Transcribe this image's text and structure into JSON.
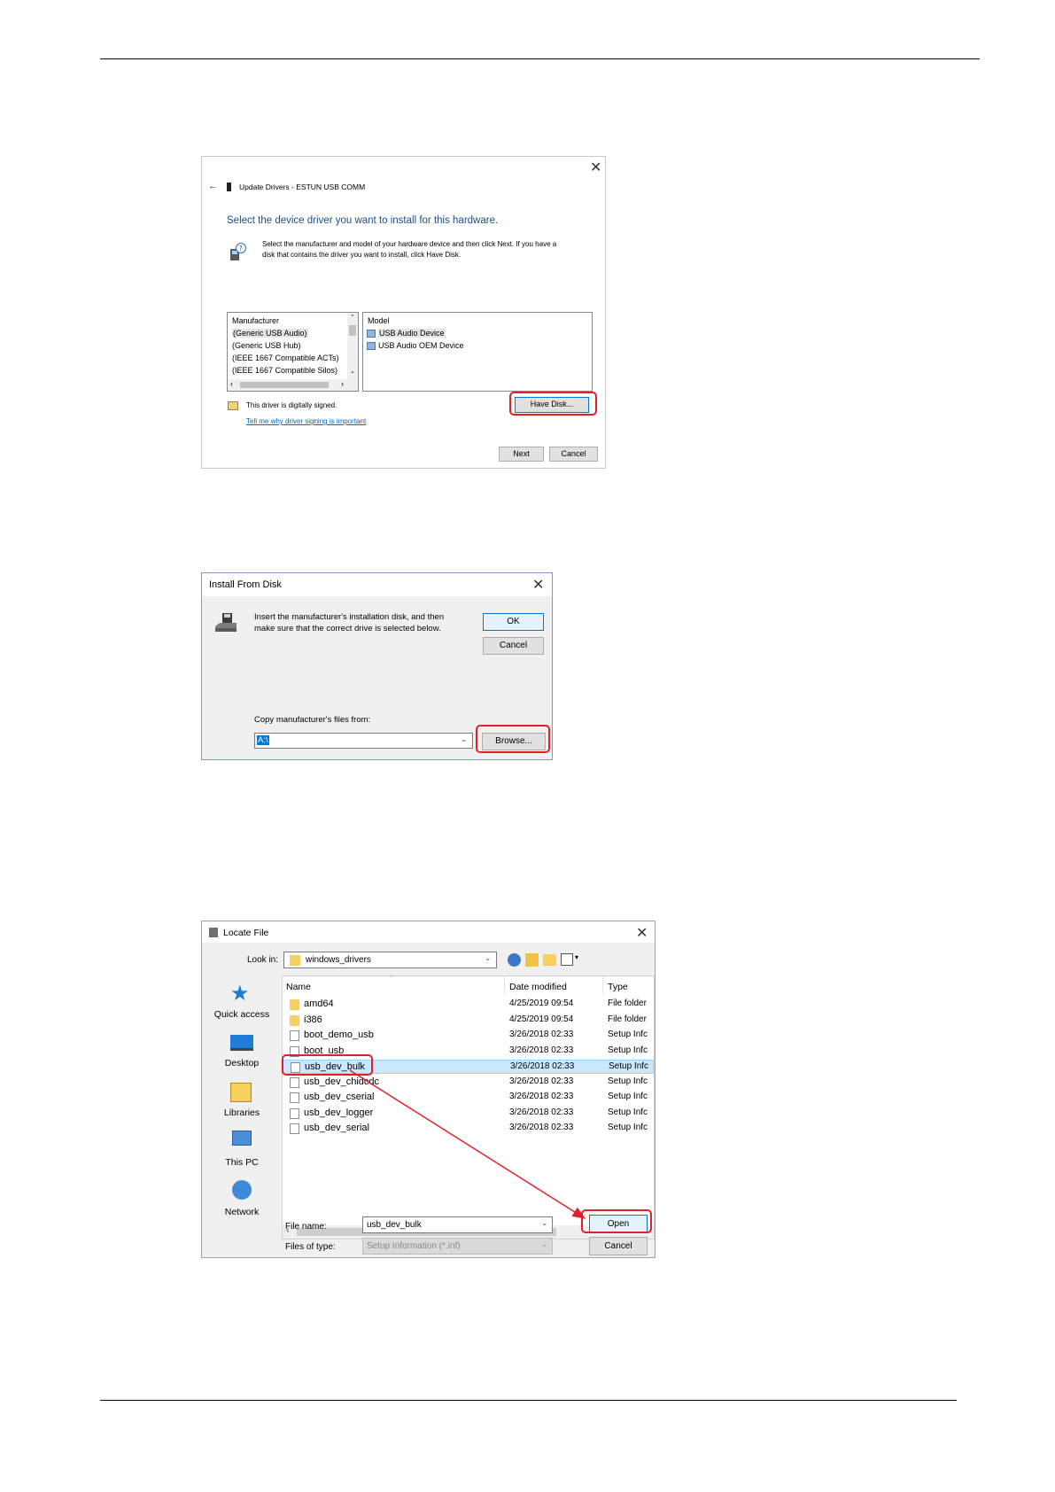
{
  "update_drivers": {
    "title": "Update Drivers - ESTUN USB COMM",
    "heading": "Select the device driver you want to install for this hardware.",
    "description_line1": "Select the manufacturer and model of your hardware device and then click Next. If you have a",
    "description_line2": "disk that contains the driver you want to install, click Have Disk.",
    "manufacturer_header": "Manufacturer",
    "manufacturers": [
      "(Generic USB Audio)",
      "(Generic USB Hub)",
      "(IEEE 1667 Compatible ACTs)",
      "(IEEE 1667 Compatible Silos)"
    ],
    "model_header": "Model",
    "models": [
      "USB Audio Device",
      "USB Audio OEM Device"
    ],
    "signed_text": "This driver is digitally signed.",
    "signing_link": "Tell me why driver signing is important",
    "have_disk_label": "Have Disk...",
    "next_label": "Next",
    "cancel_label": "Cancel"
  },
  "install_from_disk": {
    "title": "Install From Disk",
    "message_line1": "Insert the manufacturer's installation disk, and then",
    "message_line2": "make sure that the correct drive is selected below.",
    "ok_label": "OK",
    "cancel_label": "Cancel",
    "copy_label": "Copy manufacturer's files from:",
    "path_value": "A:\\",
    "browse_label": "Browse..."
  },
  "locate_file": {
    "title": "Locate File",
    "look_in_label": "Look in:",
    "look_in_value": "windows_drivers",
    "nav": [
      "Quick access",
      "Desktop",
      "Libraries",
      "This PC",
      "Network"
    ],
    "columns": [
      "Name",
      "Date modified",
      "Type"
    ],
    "files": [
      {
        "name": "amd64",
        "date": "4/25/2019 09:54",
        "type": "File folder",
        "kind": "folder"
      },
      {
        "name": "i386",
        "date": "4/25/2019 09:54",
        "type": "File folder",
        "kind": "folder"
      },
      {
        "name": "boot_demo_usb",
        "date": "3/26/2018 02:33",
        "type": "Setup Infc",
        "kind": "doc"
      },
      {
        "name": "boot_usb",
        "date": "3/26/2018 02:33",
        "type": "Setup Infc",
        "kind": "doc"
      },
      {
        "name": "usb_dev_bulk",
        "date": "3/26/2018 02:33",
        "type": "Setup Infc",
        "kind": "doc"
      },
      {
        "name": "usb_dev_chidcdc",
        "date": "3/26/2018 02:33",
        "type": "Setup Infc",
        "kind": "doc"
      },
      {
        "name": "usb_dev_cserial",
        "date": "3/26/2018 02:33",
        "type": "Setup Infc",
        "kind": "doc"
      },
      {
        "name": "usb_dev_logger",
        "date": "3/26/2018 02:33",
        "type": "Setup Infc",
        "kind": "doc"
      },
      {
        "name": "usb_dev_serial",
        "date": "3/26/2018 02:33",
        "type": "Setup Infc",
        "kind": "doc"
      }
    ],
    "selected_index": 4,
    "file_name_label": "File name:",
    "file_name_value": "usb_dev_bulk",
    "file_type_label": "Files of type:",
    "file_type_value": "Setup Information (*.inf)",
    "open_label": "Open",
    "cancel_label": "Cancel"
  },
  "colors": {
    "highlight": "#e1202a",
    "heading_blue": "#1e4e8c",
    "link_blue": "#0066cc",
    "selection": "#cce8ff"
  }
}
